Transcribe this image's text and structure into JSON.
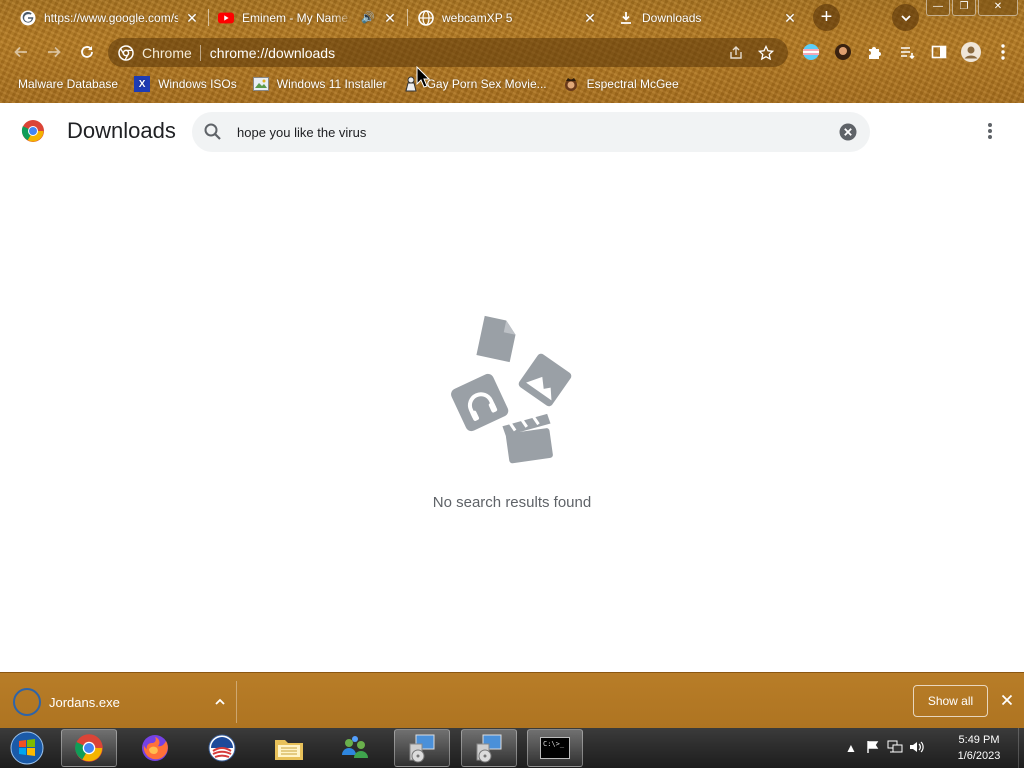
{
  "browser": {
    "tabs": [
      {
        "title": "https://www.google.com/s",
        "favicon": "google-icon",
        "active": false
      },
      {
        "title": "Eminem - My Name Is",
        "favicon": "youtube-icon",
        "audio": true,
        "active": false
      },
      {
        "title": "webcamXP 5",
        "favicon": "globe-icon",
        "active": false
      },
      {
        "title": "Downloads",
        "favicon": "download-icon",
        "active": true
      }
    ],
    "new_tab_label": "+",
    "window_controls": {
      "minimize": "—",
      "maximize": "❐",
      "close": "✕"
    },
    "omnibox": {
      "chip": "Chrome",
      "url": "chrome://downloads"
    },
    "bookmarks": [
      {
        "label": "Malware Database",
        "icon": "shield-icon"
      },
      {
        "label": "Windows ISOs",
        "icon": "x-icon"
      },
      {
        "label": "Windows 11 Installer",
        "icon": "picture-icon"
      },
      {
        "label": "Gay Porn Sex Movie...",
        "icon": "figure-icon"
      },
      {
        "label": "Espectral McGee",
        "icon": "character-icon"
      }
    ],
    "theme_color": "#b07520"
  },
  "downloads_page": {
    "title": "Downloads",
    "search_value": "hope you like the virus",
    "empty_message": "No search results found"
  },
  "shelf": {
    "item_name": "Jordans.exe",
    "show_all_label": "Show all"
  },
  "taskbar": {
    "apps": [
      "start-orb",
      "chrome-icon",
      "firefox-icon",
      "obama-logo-icon",
      "file-explorer-icon",
      "network-people-icon",
      "installer-icon",
      "installer-icon-2",
      "command-prompt-icon"
    ],
    "time": "5:49 PM",
    "date": "1/6/2023",
    "cmd_label": "C:\\>_"
  }
}
